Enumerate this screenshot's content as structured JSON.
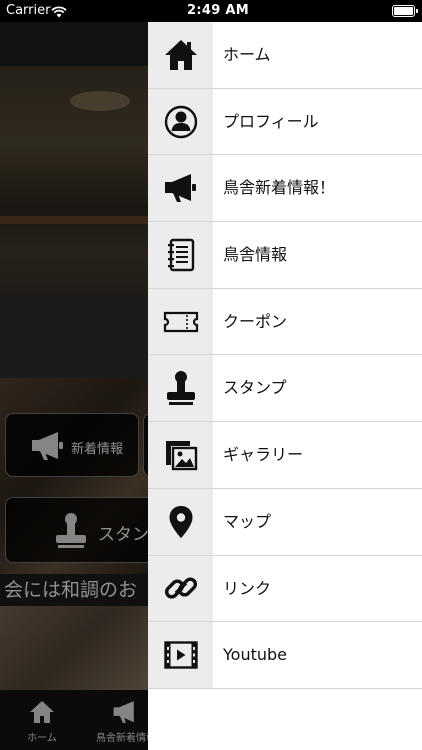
{
  "status_bar": {
    "carrier": "Carrier",
    "time": "2:49 AM"
  },
  "background": {
    "news_button_label": "新着情報",
    "stamp_button_label": "スタン",
    "ticker_text": "会には和調のお",
    "tabs": [
      {
        "label": "ホーム",
        "icon": "home-icon"
      },
      {
        "label": "鳥舎新着情報",
        "icon": "megaphone-icon"
      }
    ]
  },
  "drawer": {
    "items": [
      {
        "label": "ホーム",
        "icon": "home-icon"
      },
      {
        "label": "プロフィール",
        "icon": "profile-icon"
      },
      {
        "label": "鳥舎新着情報！",
        "icon": "megaphone-icon"
      },
      {
        "label": "鳥舎情報",
        "icon": "notebook-icon"
      },
      {
        "label": "クーポン",
        "icon": "coupon-icon"
      },
      {
        "label": "スタンプ",
        "icon": "stamp-icon"
      },
      {
        "label": "ギャラリー",
        "icon": "gallery-icon"
      },
      {
        "label": "マップ",
        "icon": "map-pin-icon"
      },
      {
        "label": "リンク",
        "icon": "link-icon"
      },
      {
        "label": "Youtube",
        "icon": "video-icon"
      }
    ]
  }
}
